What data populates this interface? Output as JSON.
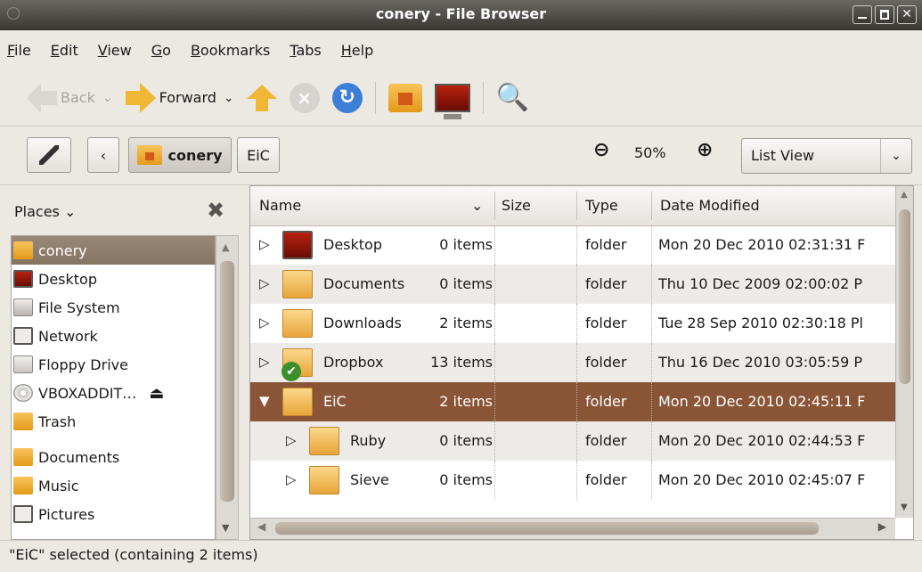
{
  "window": {
    "title": "conery - File Browser",
    "close_glyph": "✕"
  },
  "menubar": {
    "items": [
      "File",
      "Edit",
      "View",
      "Go",
      "Bookmarks",
      "Tabs",
      "Help"
    ]
  },
  "toolbar": {
    "back": "Back",
    "forward": "Forward",
    "dropdown_glyph": "⌄",
    "search_glyph": "🔍"
  },
  "location": {
    "back_glyph": "‹",
    "crumbs": [
      "conery",
      "EiC"
    ],
    "zoom_out_glyph": "⊖",
    "zoom": "50%",
    "zoom_in_glyph": "⊕",
    "view_mode": "List View",
    "view_dd_glyph": "⌄"
  },
  "sidebar": {
    "title": "Places",
    "title_chevron": "⌄",
    "close_glyph": "✖",
    "items": [
      {
        "label": "conery",
        "icon": "home-icon"
      },
      {
        "label": "Desktop",
        "icon": "desktop-icon"
      },
      {
        "label": "File System",
        "icon": "harddisk-icon"
      },
      {
        "label": "Network",
        "icon": "network-icon"
      },
      {
        "label": "Floppy Drive",
        "icon": "floppy-icon"
      },
      {
        "label": "VBOXADDIT…",
        "icon": "cdrom-icon"
      },
      {
        "label": "Trash",
        "icon": "trash-icon"
      },
      {
        "label": "Documents",
        "icon": "folder-icon"
      },
      {
        "label": "Music",
        "icon": "music-folder-icon"
      },
      {
        "label": "Pictures",
        "icon": "pictures-folder-icon"
      }
    ],
    "eject_glyph": "⏏"
  },
  "filelist": {
    "columns": [
      "Name",
      "Size",
      "Type",
      "Date Modified"
    ],
    "sort_glyph": "⌄",
    "rows": [
      {
        "name": "Desktop",
        "size": "0 items",
        "type": "folder",
        "date": "Mon 20 Dec 2010 02:31:31 F",
        "expander": "▷"
      },
      {
        "name": "Documents",
        "size": "0 items",
        "type": "folder",
        "date": "Thu 10 Dec 2009 02:00:02 P",
        "expander": "▷"
      },
      {
        "name": "Downloads",
        "size": "2 items",
        "type": "folder",
        "date": "Tue 28 Sep 2010 02:30:18 Pl",
        "expander": "▷"
      },
      {
        "name": "Dropbox",
        "size": "13 items",
        "type": "folder",
        "date": "Thu 16 Dec 2010 03:05:59 P",
        "expander": "▷"
      },
      {
        "name": "EiC",
        "size": "2 items",
        "type": "folder",
        "date": "Mon 20 Dec 2010 02:45:11 F",
        "expander": "▼"
      },
      {
        "name": "Ruby",
        "size": "0 items",
        "type": "folder",
        "date": "Mon 20 Dec 2010 02:44:53 F",
        "expander": "▷"
      },
      {
        "name": "Sieve",
        "size": "0 items",
        "type": "folder",
        "date": "Mon 20 Dec 2010 02:45:07 F",
        "expander": "▷"
      }
    ]
  },
  "status": {
    "text": "\"EiC\" selected (containing 2 items)"
  }
}
